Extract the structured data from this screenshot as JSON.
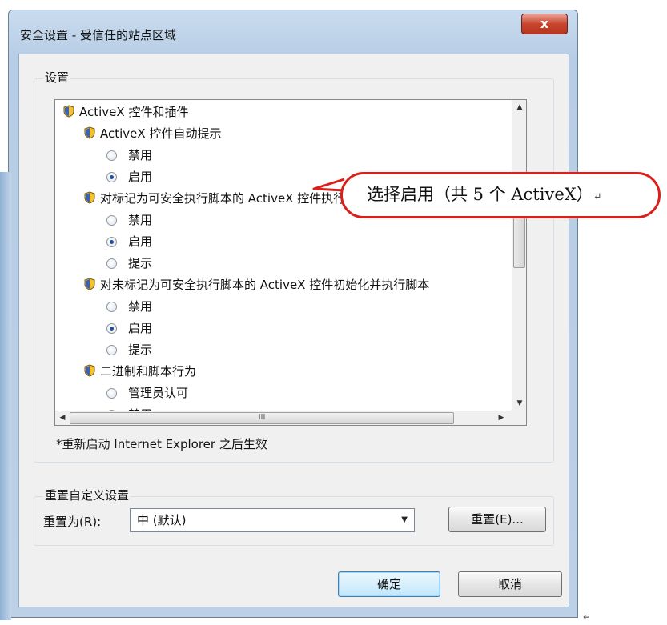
{
  "window": {
    "title": "安全设置 - 受信任的站点区域",
    "close_glyph": "x"
  },
  "settings": {
    "group_label": "设置",
    "tree": [
      {
        "type": "category",
        "icon": "settings-shield-icon",
        "label": "ActiveX 控件和插件"
      },
      {
        "type": "setting",
        "icon": "settings-shield-icon",
        "label": "ActiveX 控件自动提示"
      },
      {
        "type": "option",
        "label": "禁用",
        "checked": false
      },
      {
        "type": "option",
        "label": "启用",
        "checked": true
      },
      {
        "type": "setting",
        "icon": "settings-shield-icon",
        "label": "对标记为可安全执行脚本的 ActiveX 控件执行脚本"
      },
      {
        "type": "option",
        "label": "禁用",
        "checked": false
      },
      {
        "type": "option",
        "label": "启用",
        "checked": true
      },
      {
        "type": "option",
        "label": "提示",
        "checked": false
      },
      {
        "type": "setting",
        "icon": "settings-shield-icon",
        "label": "对未标记为可安全执行脚本的 ActiveX 控件初始化并执行脚本"
      },
      {
        "type": "option",
        "label": "禁用",
        "checked": false
      },
      {
        "type": "option",
        "label": "启用",
        "checked": true
      },
      {
        "type": "option",
        "label": "提示",
        "checked": false
      },
      {
        "type": "setting",
        "icon": "settings-shield-icon",
        "label": "二进制和脚本行为"
      },
      {
        "type": "option",
        "label": "管理员认可",
        "checked": false
      },
      {
        "type": "option",
        "label": "禁用",
        "checked": false
      }
    ],
    "hscroll_grip": "III",
    "note": "*重新启动 Internet Explorer 之后生效"
  },
  "reset": {
    "group_label": "重置自定义设置",
    "label": "重置为(R):",
    "selected": "中 (默认)",
    "button": "重置(E)..."
  },
  "footer": {
    "ok": "确定",
    "cancel": "取消"
  },
  "annotation": {
    "text": "选择启用（共 5 个 ActiveX）",
    "color": "#d9201b"
  },
  "paragraph_mark": "↵"
}
